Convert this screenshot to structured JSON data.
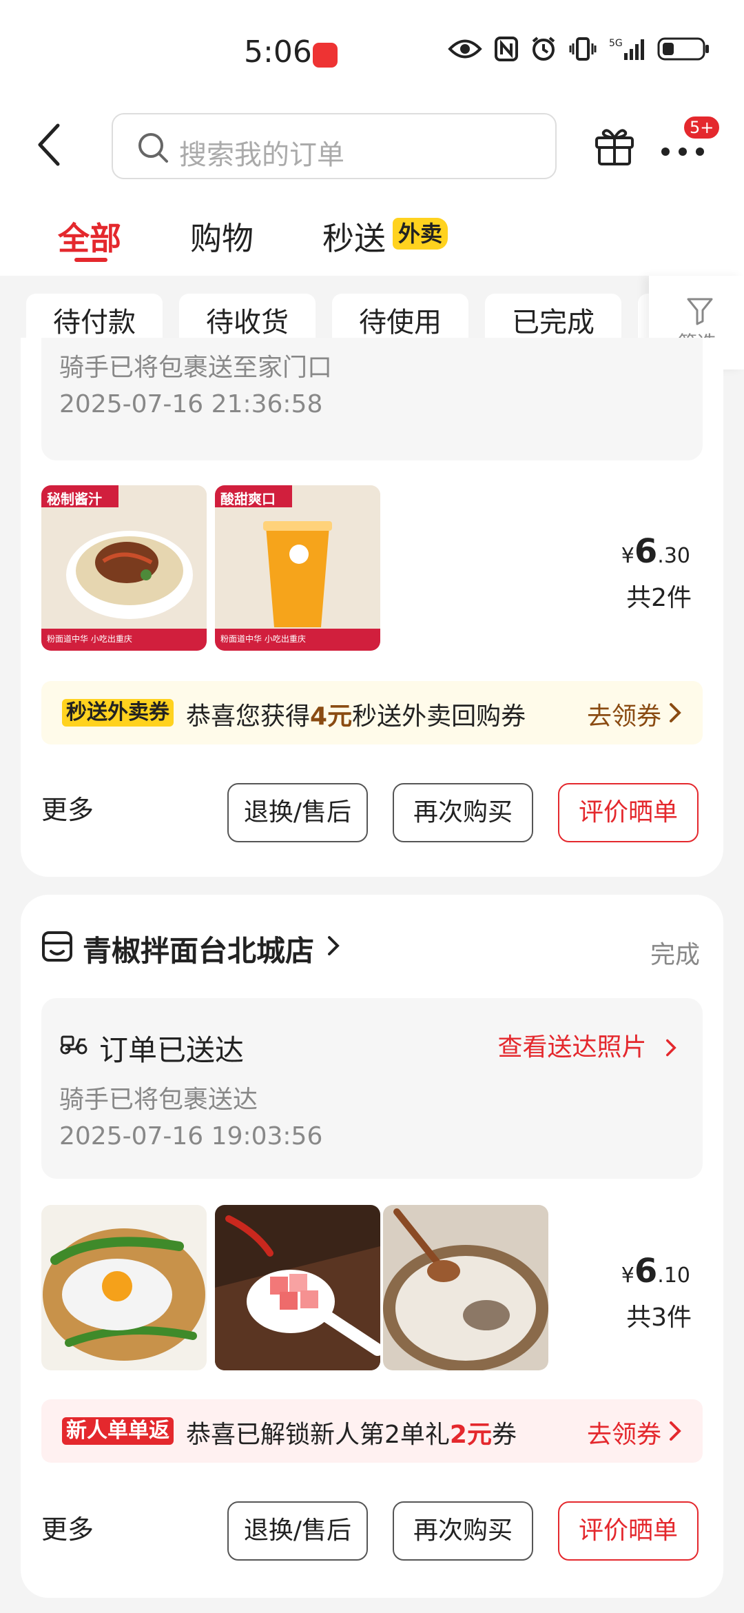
{
  "status_bar": {
    "time": "5:06",
    "network": "5G"
  },
  "header": {
    "search_placeholder": "搜索我的订单",
    "more_badge": "5+"
  },
  "tabs": [
    {
      "label": "全部",
      "active": true
    },
    {
      "label": "购物",
      "active": false
    },
    {
      "label": "秒送",
      "active": false,
      "tag": "外卖"
    }
  ],
  "filters": {
    "chips": [
      "待付款",
      "待收货",
      "待使用",
      "已完成"
    ],
    "filter_label": "筛选"
  },
  "orders": [
    {
      "delivery_subtitle": "骑手已将包裹送至家门口",
      "delivery_time": "2025-07-16 21:36:58",
      "price_symbol": "¥",
      "price_int": "6",
      "price_dec": ".30",
      "qty": "共2件",
      "promo": {
        "tag": "秒送外卖券",
        "text_before": "恭喜您获得",
        "highlight": "4元",
        "text_after": "秒送外卖回购券",
        "link": "去领券"
      },
      "more_label": "更多",
      "buttons": [
        "退换/售后",
        "再次购买",
        "评价晒单"
      ],
      "thumb_texts": [
        {
          "top": "秘制酱汁",
          "bottom": "粉面道中华 小吃出重庆"
        },
        {
          "top": "酸甜爽口",
          "bottom": "粉面道中华 小吃出重庆"
        }
      ]
    },
    {
      "store_name": "青椒拌面台北城店",
      "status": "完成",
      "delivery_title": "订单已送达",
      "delivery_link": "查看送达照片",
      "delivery_subtitle": "骑手已将包裹送达",
      "delivery_time": "2025-07-16 19:03:56",
      "price_symbol": "¥",
      "price_int": "6",
      "price_dec": ".10",
      "qty": "共3件",
      "promo": {
        "tag": "新人单单返",
        "text_before": "恭喜已解锁新人第2单礼",
        "highlight": "2元",
        "text_after": "券",
        "link": "去领券"
      },
      "more_label": "更多",
      "buttons": [
        "退换/售后",
        "再次购买",
        "评价晒单"
      ]
    }
  ],
  "colors": {
    "accent": "#e4282d",
    "promo_yellow_bg": "#fffbea",
    "promo_red_bg": "#fff1f1",
    "tag_yellow": "#ffd21f",
    "link_brown": "#8a4b12"
  }
}
